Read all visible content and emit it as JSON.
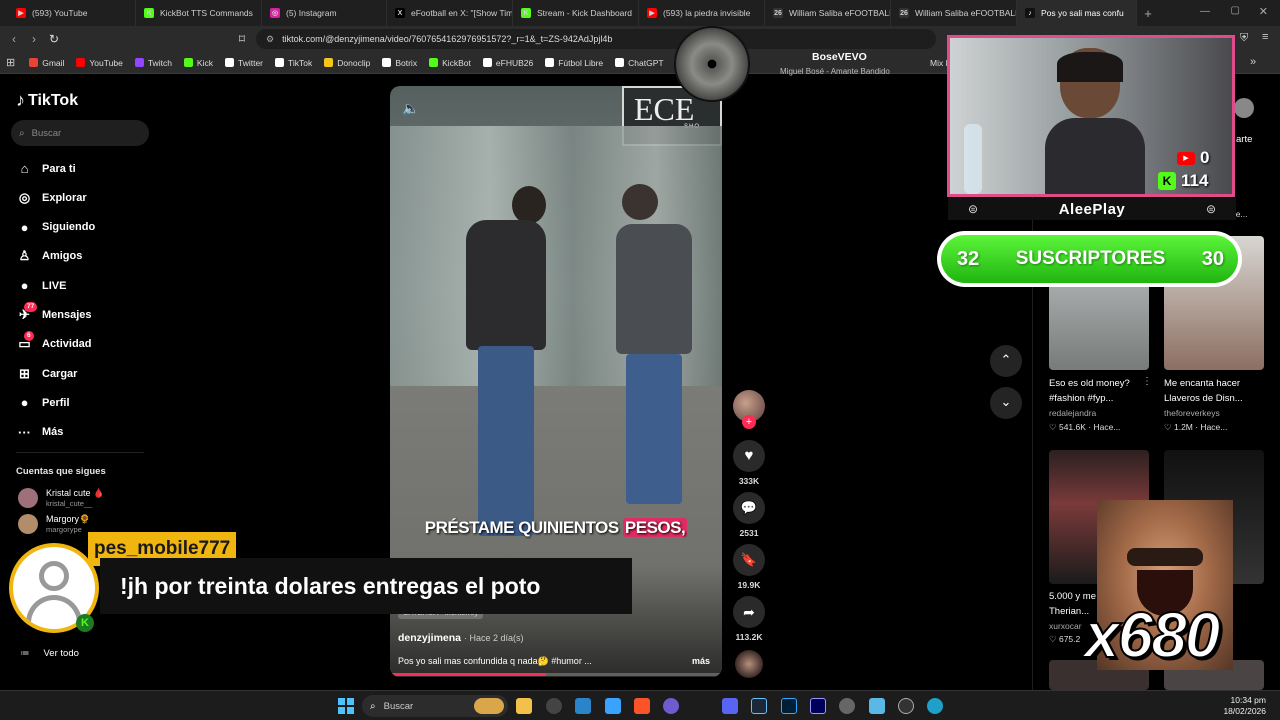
{
  "browser": {
    "tabs": [
      {
        "label": "(593) YouTube",
        "color": "#ff0000",
        "glyph": "▶"
      },
      {
        "label": "KickBot TTS Commands",
        "color": "#53fc18",
        "glyph": "K"
      },
      {
        "label": "(5) Instagram",
        "color": "#d6249f",
        "glyph": "◎"
      },
      {
        "label": "eFootball en X: \"[Show Tim",
        "color": "#000000",
        "glyph": "X"
      },
      {
        "label": "Stream - Kick Dashboard",
        "color": "#53fc18",
        "glyph": "K"
      },
      {
        "label": "(593) la piedra invisible",
        "color": "#ff0000",
        "glyph": "▶"
      },
      {
        "label": "William Saliba eFOOTBALL",
        "color": "#333333",
        "glyph": "26"
      },
      {
        "label": "William Saliba eFOOTBALL",
        "color": "#333333",
        "glyph": "26"
      },
      {
        "label": "Pos yo sali mas confu",
        "color": "#111111",
        "glyph": "♪"
      }
    ],
    "url": "tiktok.com/@denzyjimena/video/7607654162976951572?_r=1&_t=ZS-942AdJpjl4b",
    "bookmarks": [
      {
        "label": "Gmail",
        "color": "#ea4335"
      },
      {
        "label": "YouTube",
        "color": "#ff0000"
      },
      {
        "label": "Twitch",
        "color": "#9146ff"
      },
      {
        "label": "Kick",
        "color": "#53fc18"
      },
      {
        "label": "Twitter",
        "color": "#ffffff"
      },
      {
        "label": "TikTok",
        "color": "#ffffff"
      },
      {
        "label": "Donoclip",
        "color": "#f5c518"
      },
      {
        "label": "Botrix",
        "color": "#ffffff"
      },
      {
        "label": "KickBot",
        "color": "#53fc18"
      },
      {
        "label": "eFHUB26",
        "color": "#ffffff"
      },
      {
        "label": "Fútbol Libre",
        "color": "#ffffff"
      },
      {
        "label": "ChatGPT",
        "color": "#ffffff"
      }
    ],
    "bookmarks_more": "Mix N"
  },
  "tiktok": {
    "logo": "TikTok",
    "search_placeholder": "Buscar",
    "nav": [
      {
        "label": "Para ti",
        "icon": "home-icon",
        "glyph": "⌂"
      },
      {
        "label": "Explorar",
        "icon": "compass-icon",
        "glyph": "◎"
      },
      {
        "label": "Siguiendo",
        "icon": "following-icon",
        "glyph": "●"
      },
      {
        "label": "Amigos",
        "icon": "friends-icon",
        "glyph": "♙"
      },
      {
        "label": "LIVE",
        "icon": "live-icon",
        "glyph": "●"
      },
      {
        "label": "Mensajes",
        "icon": "messages-icon",
        "glyph": "✈",
        "badge": "77"
      },
      {
        "label": "Actividad",
        "icon": "activity-icon",
        "glyph": "▭",
        "badge": "6"
      },
      {
        "label": "Cargar",
        "icon": "upload-icon",
        "glyph": "⊞"
      },
      {
        "label": "Perfil",
        "icon": "profile-icon",
        "glyph": "●"
      },
      {
        "label": "Más",
        "icon": "more-icon",
        "glyph": "···"
      }
    ],
    "following_title": "Cuentas que sigues",
    "following": [
      {
        "name": "Kristal cute 🩸",
        "handle": "kristal_cute__"
      },
      {
        "name": "Margory🌻",
        "handle": "margorype"
      }
    ],
    "see_all": "Ver todo",
    "video": {
      "store_sign": "ECE",
      "store_sub": "SHO",
      "subtitle_a": "PRÉSTAME QUINIENTOS ",
      "subtitle_b": "PESOS,",
      "location": "CATEHUA · Monterrey",
      "author": "denzyjimena",
      "time": "· Hace 2 día(s)",
      "caption": "Pos yo sali mas confundida q nada🤔 #humor ...",
      "more": "más"
    },
    "actions": {
      "likes": "333K",
      "comments": "2531",
      "saves": "19.9K",
      "shares": "113.2K"
    },
    "recommended": [
      {
        "caption1": "Eso es old money?",
        "caption2": "#fashion #fyp...",
        "user": "redalejandra",
        "stats": "♡ 541.6K · Hace..."
      },
      {
        "caption1": "Me encanta hacer",
        "caption2": "Llaveros de Disn...",
        "user": "theforeverkeys",
        "stats": "♡ 1.2M · Hace..."
      },
      {
        "caption1": "5.000 y me",
        "caption2": "Therian...",
        "user": "xurxocar",
        "stats": "♡ 675.2"
      },
      {
        "caption1": "",
        "caption2": "",
        "user": "",
        "stats": ""
      }
    ],
    "top_right_caption": "arte",
    "top_right_meta": "hace..."
  },
  "music_overlay": {
    "artist": "BoseVEVO",
    "track": "Miguel Bosé - Amante Bandido"
  },
  "stream_overlay": {
    "streamer": "AleePlay",
    "youtube_count": "0",
    "kick_count": "114",
    "subs_left": "32",
    "subs_label": "SUSCRIPTORES",
    "subs_right": "30",
    "chat_user": "pes_mobile777",
    "chat_message": "!jh por treinta dolares entregas el poto",
    "multiplier": "x680"
  },
  "taskbar": {
    "search": "Buscar",
    "time": "10:34 pm",
    "date": "18/02/2026"
  }
}
